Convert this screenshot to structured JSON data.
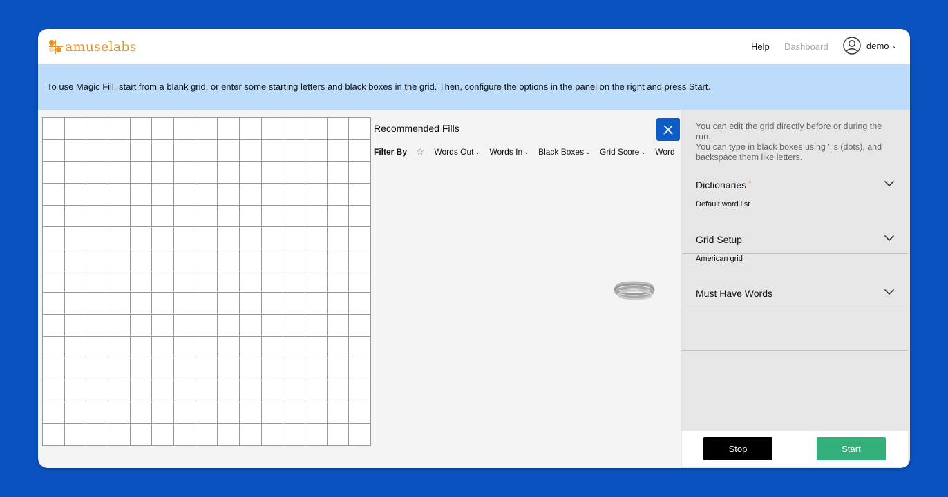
{
  "header": {
    "logo": {
      "amuse": "amuse",
      "labs": "labs"
    },
    "help_label": "Help",
    "dashboard_label": "Dashboard",
    "user_name": "demo"
  },
  "banner": {
    "text": "To use Magic Fill, start from a blank grid, or enter some starting letters and black boxes in the grid. Then, configure the options in the panel on the right and press Start."
  },
  "grid": {
    "rows": 15,
    "cols": 15
  },
  "recommended": {
    "title": "Recommended Fills",
    "filter_label": "Filter By",
    "filters": [
      "Words Out",
      "Words In",
      "Black Boxes",
      "Grid Score",
      "Word"
    ]
  },
  "panel": {
    "info_line1": "You can edit the grid directly before or during the run.",
    "info_line2": "You can type in black boxes using '.'s (dots), and backspace them like letters.",
    "sections": [
      {
        "title": "Dictionaries",
        "required": "*",
        "value": "Default word list"
      },
      {
        "title": "Grid Setup",
        "value": "American grid"
      },
      {
        "title": "Must Have Words",
        "value": ""
      }
    ],
    "stop_label": "Stop",
    "start_label": "Start"
  },
  "colors": {
    "background": "#0a52c0",
    "banner": "#bcdcf9",
    "close_button": "#0d5bc7",
    "start_button": "#33b07a",
    "logo_orange": "#e8922b",
    "logo_gold": "#c7a034"
  }
}
